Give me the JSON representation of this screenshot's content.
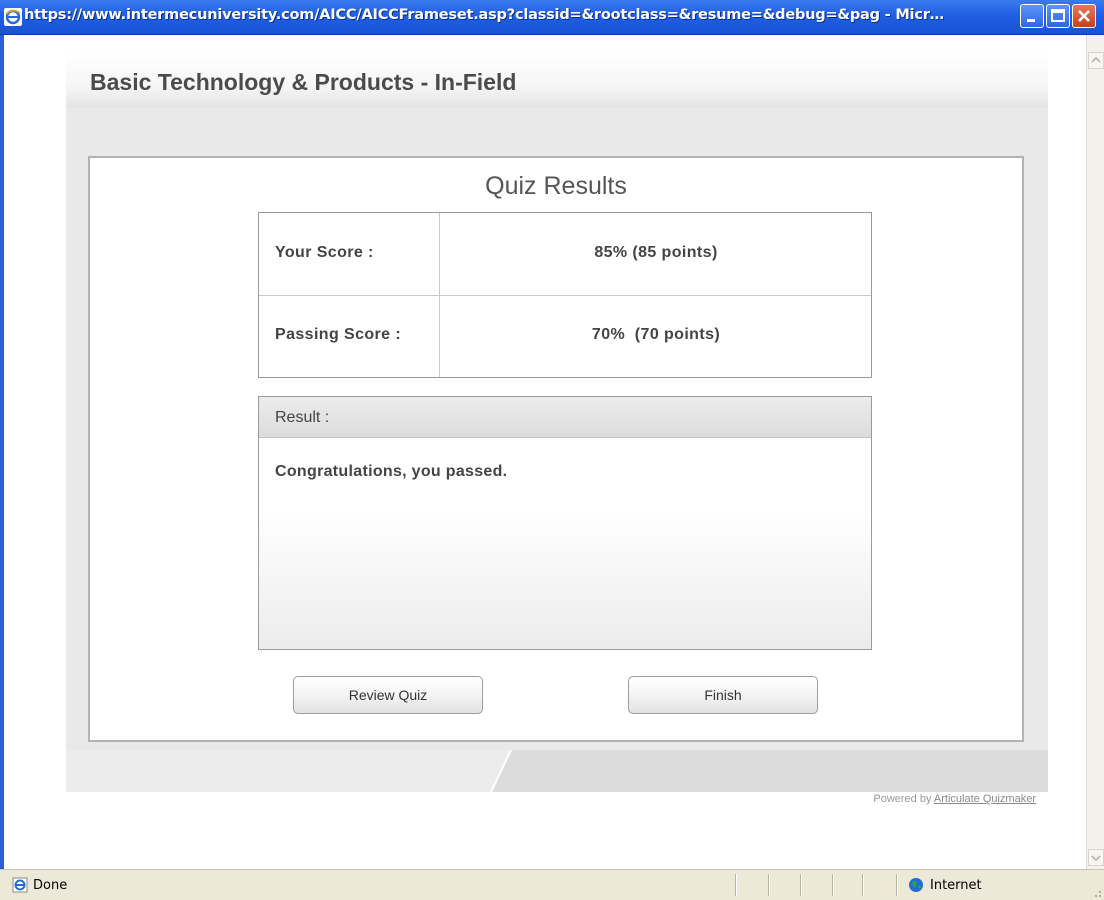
{
  "window": {
    "title": "https://www.intermecuniversity.com/AICC/AICCFrameset.asp?classid=&rootclass=&resume=&debug=&pag - Micr…",
    "icon": "ie-icon",
    "controls": [
      "minimize-icon",
      "maximize-icon",
      "close-icon"
    ]
  },
  "course": {
    "title": "Basic Technology & Products - In-Field"
  },
  "results": {
    "title": "Quiz Results",
    "rows": [
      {
        "label": "Your Score :",
        "value": "85% (85 points)"
      },
      {
        "label": "Passing Score :",
        "value": "70%  (70 points)"
      }
    ],
    "result_label": "Result :",
    "result_message": "Congratulations, you passed."
  },
  "buttons": {
    "review": "Review Quiz",
    "finish": "Finish"
  },
  "footer": {
    "powered_prefix": "Powered by ",
    "powered_link": "Articulate Quizmaker"
  },
  "statusbar": {
    "text": "Done",
    "zone": "Internet",
    "zone_icon": "globe-icon"
  },
  "colors": {
    "titlebar": "#1f5fe3",
    "close_button": "#c8401c",
    "frame_bg": "#e9e9e9",
    "text": "#444444"
  }
}
